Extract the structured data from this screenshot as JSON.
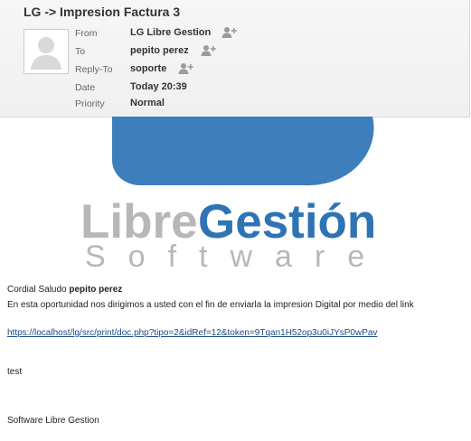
{
  "message": {
    "subject": "LG -> Impresion Factura 3"
  },
  "headers": {
    "from": {
      "label": "From",
      "value": "LG Libre Gestion",
      "icon": "add-contact-icon"
    },
    "to": {
      "label": "To",
      "value": "pepito perez",
      "icon": "add-contact-icon"
    },
    "reply_to": {
      "label": "Reply-To",
      "value": "soporte",
      "icon": "add-contact-icon"
    },
    "date": {
      "label": "Date",
      "value": "Today 20:39"
    },
    "priority": {
      "label": "Priority",
      "value": "Normal"
    }
  },
  "logo": {
    "word1": "Libre",
    "word2": "Gestión",
    "tagline": "Software",
    "colors": {
      "cloud": "#3d7ebd",
      "gray": "#b7b7b7",
      "blue": "#2e74b5"
    }
  },
  "body": {
    "greeting": "Cordial Saludo",
    "greeting_name": "pepito perez",
    "intro": "En esta oportunidad nos dirigimos a usted con el fin de enviarla la impresion Digital por medio del link",
    "link": "https://localhost/lg/src/print/doc.php?tipo=2&idRef=12&token=9Tqan1H52op3u0iJYsP0wPav",
    "note": "test",
    "signature": "Software Libre Gestion"
  }
}
